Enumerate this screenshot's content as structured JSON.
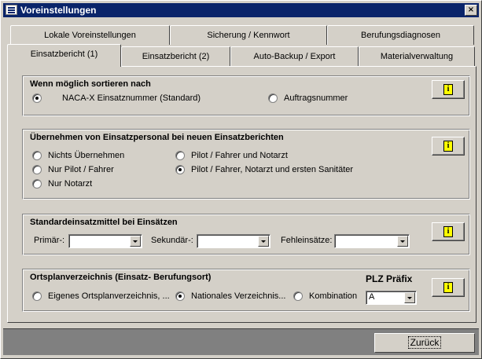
{
  "window": {
    "title": "Voreinstellungen",
    "close": "×"
  },
  "tabs_row1": [
    {
      "label": "Lokale Voreinstellungen"
    },
    {
      "label": "Sicherung / Kennwort"
    },
    {
      "label": "Berufungsdiagnosen"
    }
  ],
  "tabs_row2": [
    {
      "label": "Einsatzbericht (1)",
      "active": true
    },
    {
      "label": "Einsatzbericht (2)"
    },
    {
      "label": "Auto-Backup / Export"
    },
    {
      "label": "Materialverwaltung"
    }
  ],
  "sort": {
    "title": "Wenn möglich sortieren nach",
    "options": [
      {
        "label": "NACA-X Einsatznummer (Standard)",
        "checked": true
      },
      {
        "label": "Auftragsnummer",
        "checked": false
      }
    ]
  },
  "personnel": {
    "title": "Übernehmen von Einsatzpersonal bei neuen Einsatzberichten",
    "options": [
      {
        "label": "Nichts Übernehmen",
        "checked": false
      },
      {
        "label": "Nur Pilot / Fahrer",
        "checked": false
      },
      {
        "label": "Nur Notarzt",
        "checked": false
      },
      {
        "label": "Pilot / Fahrer und Notarzt",
        "checked": false
      },
      {
        "label": "Pilot / Fahrer, Notarzt und ersten Sanitäter",
        "checked": true
      }
    ]
  },
  "resources": {
    "title": "Standardeinsatzmittel bei Einsätzen",
    "primary_label": "Primär-:",
    "primary_value": "",
    "secondary_label": "Sekundär-:",
    "secondary_value": "",
    "failed_label": "Fehleinsätze:",
    "failed_value": ""
  },
  "maps": {
    "title": "Ortsplanverzeichnis (Einsatz- Berufungsort)",
    "plz_label": "PLZ Präfix",
    "plz_value": "A",
    "options": [
      {
        "label": "Eigenes Ortsplanverzeichnis, ...",
        "checked": false
      },
      {
        "label": "Nationales Verzeichnis...",
        "checked": true
      },
      {
        "label": "Kombination",
        "checked": false
      }
    ]
  },
  "info_icon": "i",
  "footer": {
    "back_label": "Zurück"
  },
  "colors": {
    "titlebar": "#0a246a",
    "face": "#d4d0c8",
    "footer": "#808080",
    "info": "#ffff00"
  }
}
